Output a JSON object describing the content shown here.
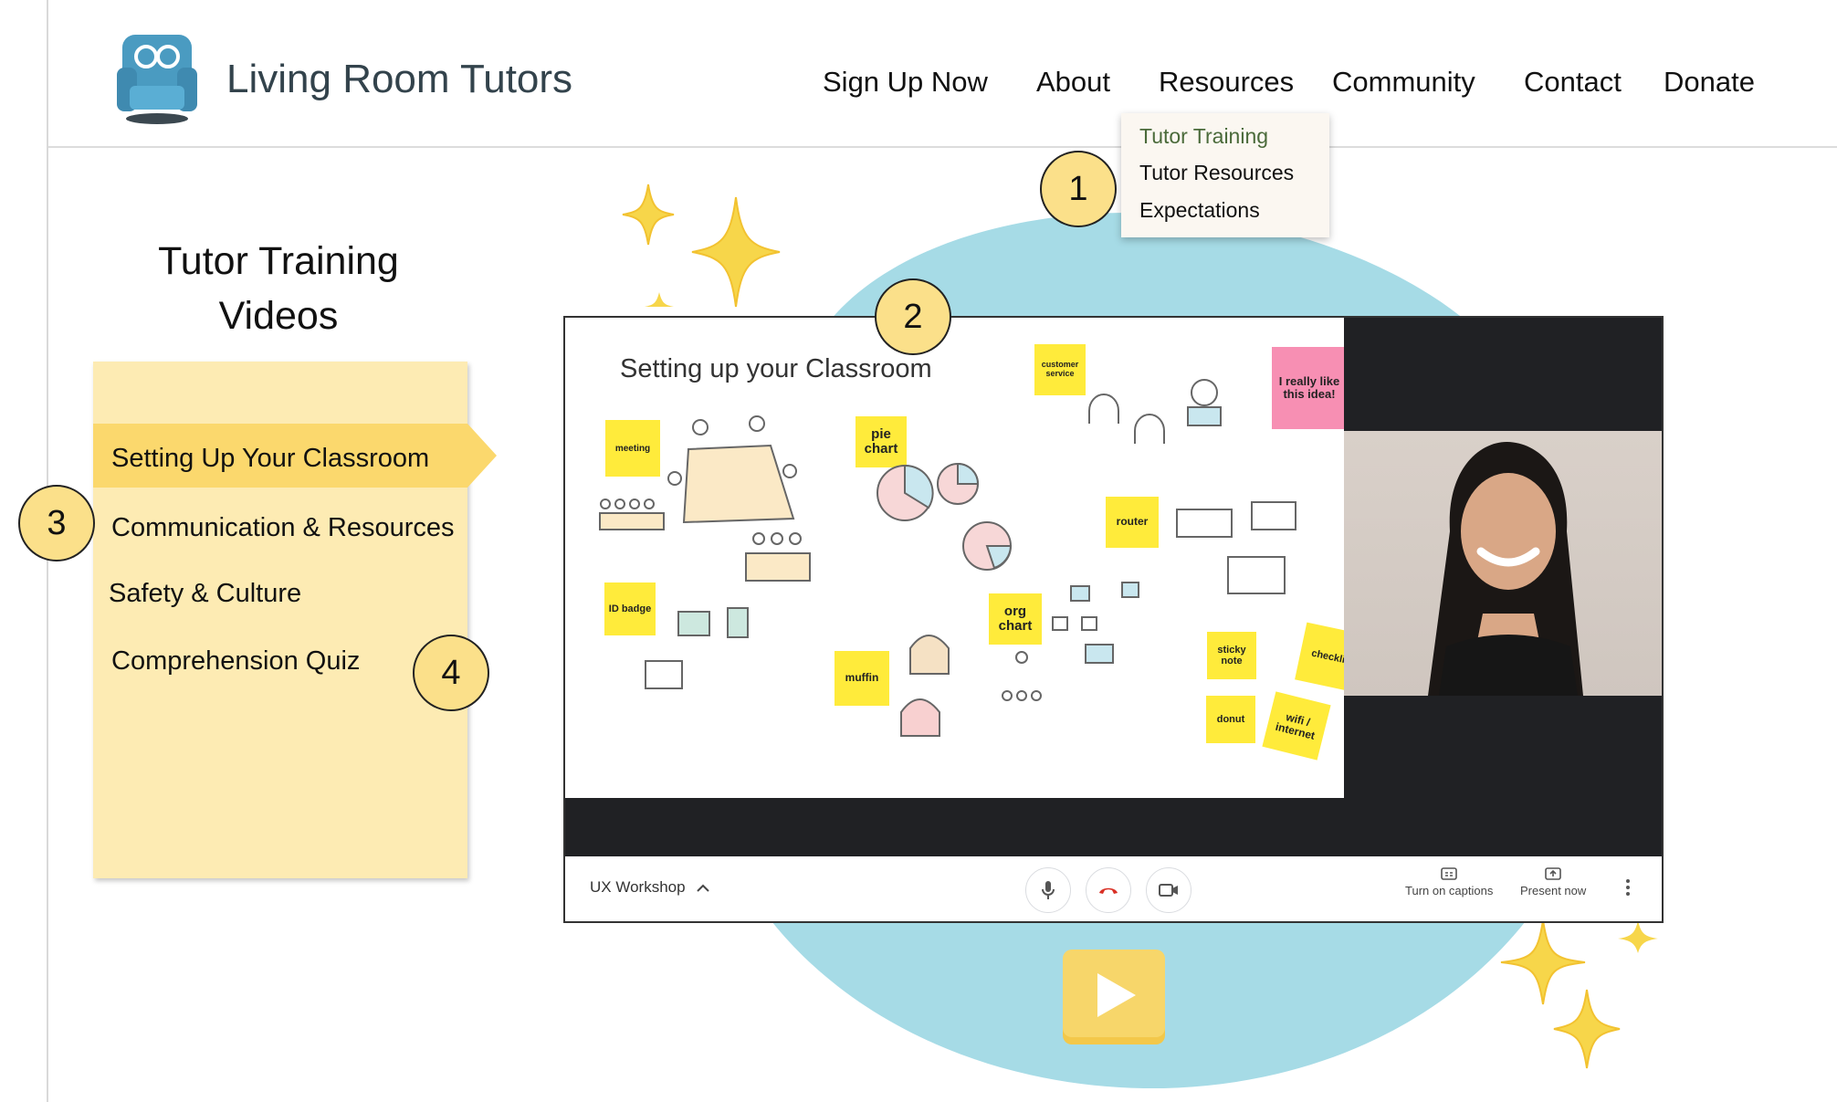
{
  "brand": {
    "name": "Living Room Tutors"
  },
  "nav": [
    {
      "label": "Sign Up Now"
    },
    {
      "label": "About"
    },
    {
      "label": "Resources"
    },
    {
      "label": "Community"
    },
    {
      "label": "Contact"
    },
    {
      "label": "Donate"
    }
  ],
  "dropdown": {
    "items": [
      {
        "label": "Tutor Training",
        "active": true
      },
      {
        "label": "Tutor Resources",
        "active": false
      },
      {
        "label": "Expectations",
        "active": false
      }
    ]
  },
  "callouts": [
    "1",
    "2",
    "3",
    "4"
  ],
  "sidebar": {
    "title_line1": "Tutor Training",
    "title_line2": "Videos",
    "items": [
      {
        "label": "Setting Up Your Classroom",
        "active": true
      },
      {
        "label": "Communication & Resources",
        "active": false
      },
      {
        "label": "Safety & Culture",
        "active": false
      },
      {
        "label": "Comprehension Quiz",
        "active": false
      }
    ]
  },
  "slide": {
    "title": "Setting up your Classroom",
    "notes": [
      "customer service",
      "I really like this idea!",
      "meeting",
      "pie chart",
      "router",
      "ID badge",
      "org chart",
      "muffin",
      "sticky note",
      "checklis",
      "donut",
      "wifi / internet"
    ]
  },
  "meeting": {
    "name": "UX Workshop",
    "captions_label": "Turn on captions",
    "present_label": "Present now"
  },
  "colors": {
    "accent_yellow": "#fbd86d",
    "panel_yellow": "#fdebb3",
    "blob_blue": "#a6dbe6",
    "brand_text": "#33434c",
    "hangup_red": "#d93025"
  },
  "icons": [
    "chair-logo-icon",
    "mic-icon",
    "hangup-icon",
    "camera-icon",
    "captions-icon",
    "present-icon",
    "more-icon",
    "chevron-up-icon",
    "play-icon",
    "sparkle-icon"
  ]
}
